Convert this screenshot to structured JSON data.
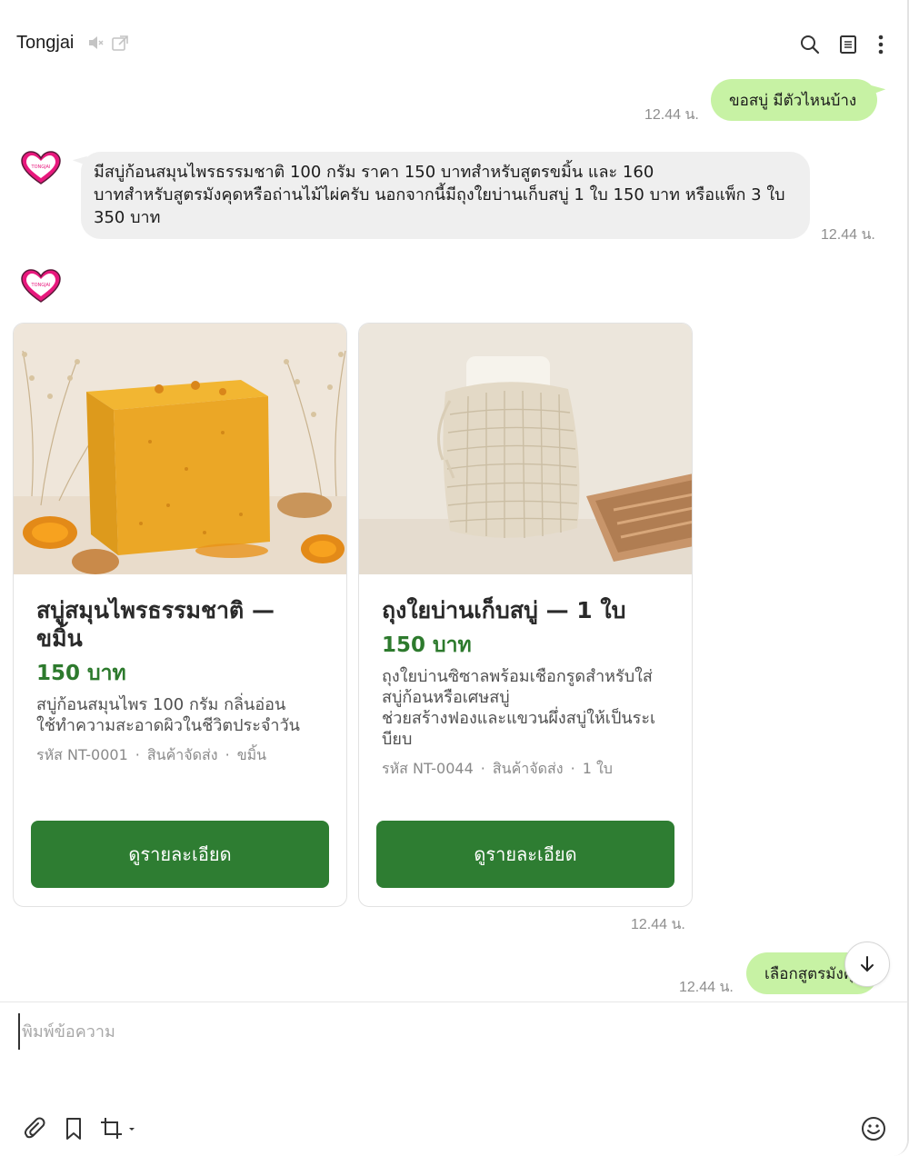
{
  "header": {
    "title": "Tongjai",
    "icons": [
      "speaker-mute-icon",
      "external-link-icon",
      "search-icon",
      "notes-icon",
      "more-vertical-icon"
    ]
  },
  "messages": [
    {
      "from": "me",
      "text": "ขอสบู่ มีตัวไหนบ้าง",
      "time": "12.44 น."
    },
    {
      "from": "bot",
      "lines": [
        "มีสบู่ก้อนสมุนไพรธรรมชาติ 100 กรัม ราคา 150 บาทสำหรับสูตรขมิ้น และ 160",
        "บาทสำหรับสูตรมังคุดหรือถ่านไม้ไผ่ครับ นอกจากนี้มีถุงใยบ่านเก็บสบู่ 1  ใบ 150 บาท หรือแพ็ก 3  ใบ",
        "350 บาท"
      ],
      "time": "12.44 น."
    },
    {
      "from": "me",
      "text": "เลือกสูตรมังคุด",
      "time": "12.44 น."
    }
  ],
  "cards_time": "12.44 น.",
  "cards": [
    {
      "title_lines": [
        "สบู่สมุนไพรธรรมชาติ —",
        "ขมิ้น"
      ],
      "price": "150 บาท",
      "desc_lines": [
        "สบู่ก้อนสมุนไพร 100 กรัม กลิ่นอ่อน",
        "ใช้ทำความสะอาดผิวในชีวิตประจำวัน"
      ],
      "code": "รหัส NT-0001",
      "shipping": "สินค้าจัดส่ง",
      "variant": "ขมิ้น",
      "button": "ดูรายละเอียด"
    },
    {
      "title_lines": [
        "ถุงใยบ่านเก็บสบู่ — 1  ใบ"
      ],
      "price": "150 บาท",
      "desc_lines": [
        "ถุงใยบ่านซิซาลพร้อมเชือกรูดสำหรับใส่",
        "สบู่ก้อนหรือเศษสบู่",
        "ช่วยสร้างฟองและแขวนผึ่งสบู่ให้เป็นระเ",
        "บียบ"
      ],
      "code": "รหัส NT-0044",
      "shipping": "สินค้าจัดส่ง",
      "variant": "1  ใบ",
      "button": "ดูรายละเอียด"
    }
  ],
  "composer": {
    "placeholder": "พิมพ์ข้อความ",
    "tools": [
      "paperclip-icon",
      "bookmark-icon",
      "crop-icon",
      "emoji-icon"
    ]
  },
  "colors": {
    "outgoing_bubble": "#c7f2a4",
    "incoming_bubble": "#efefef",
    "accent_green": "#2e7d32",
    "avatar_pink": "#e8197d"
  }
}
